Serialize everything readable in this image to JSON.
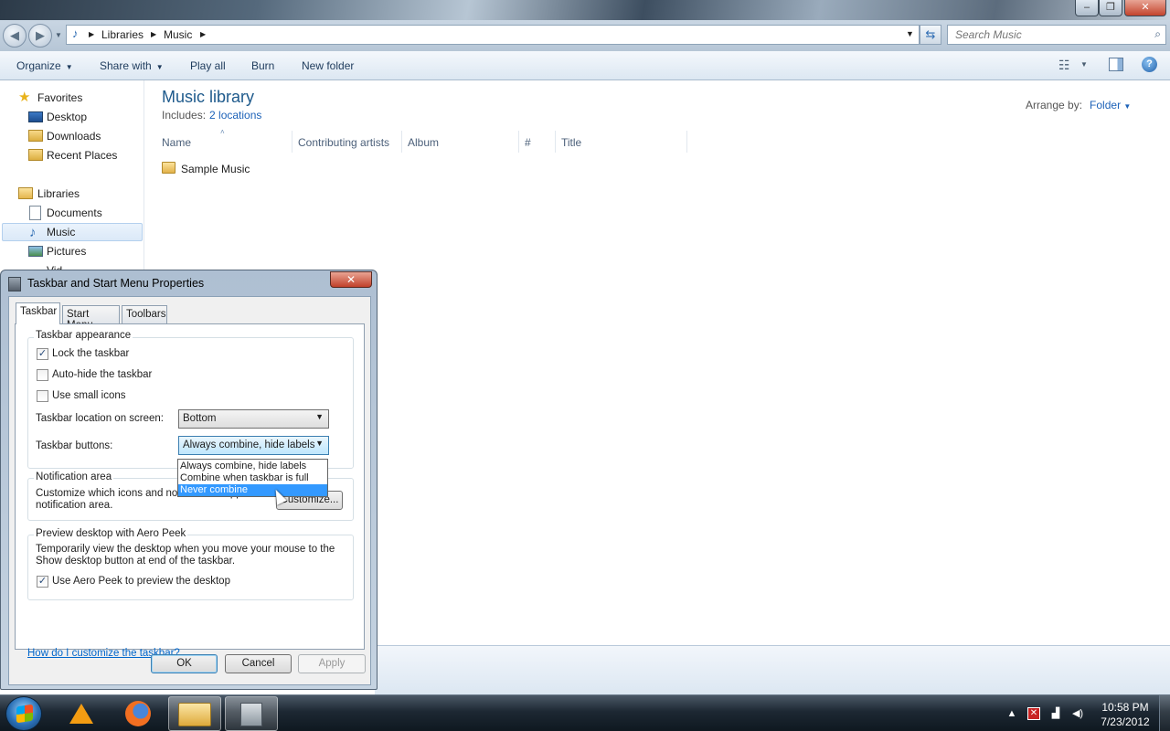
{
  "explorer": {
    "window_controls": {
      "minimize": "‒",
      "maximize": "❐",
      "close": "✕"
    },
    "address": {
      "crumbs": [
        "Libraries",
        "Music"
      ]
    },
    "search": {
      "placeholder": "Search Music"
    },
    "commands": {
      "organize": "Organize",
      "share_with": "Share with",
      "play_all": "Play all",
      "burn": "Burn",
      "new_folder": "New folder"
    },
    "nav": {
      "favorites": "Favorites",
      "desktop": "Desktop",
      "downloads": "Downloads",
      "recent_places": "Recent Places",
      "libraries": "Libraries",
      "documents": "Documents",
      "music": "Music",
      "pictures": "Pictures",
      "videos_partial": "Vid..."
    },
    "library": {
      "title": "Music library",
      "includes_label": "Includes:",
      "includes_link": "2 locations",
      "arrange_label": "Arrange by:",
      "arrange_value": "Folder"
    },
    "columns": [
      "Name",
      "Contributing artists",
      "Album",
      "#",
      "Title"
    ],
    "items": [
      {
        "name": "Sample Music"
      }
    ]
  },
  "dialog": {
    "title": "Taskbar and Start Menu Properties",
    "close": "✕",
    "tabs": [
      "Taskbar",
      "Start Menu",
      "Toolbars"
    ],
    "appearance": {
      "label": "Taskbar appearance",
      "lock": {
        "label": "Lock the taskbar",
        "checked": true
      },
      "autohide": {
        "label": "Auto-hide the taskbar",
        "checked": false
      },
      "small_icons": {
        "label": "Use small icons",
        "checked": false
      },
      "location_label": "Taskbar location on screen:",
      "location_value": "Bottom",
      "buttons_label": "Taskbar buttons:",
      "buttons_value": "Always combine, hide labels",
      "buttons_options": [
        "Always combine, hide labels",
        "Combine when taskbar is full",
        "Never combine"
      ],
      "highlighted_option": "Never combine"
    },
    "notification": {
      "label": "Notification area",
      "text_line1": "Customize which icons and notifications appear in the",
      "text_line2": "notification area.",
      "customize_button": "Customize..."
    },
    "aero_peek": {
      "label": "Preview desktop with Aero Peek",
      "text_line1": "Temporarily view the desktop when you move your mouse to the",
      "text_line2": "Show desktop button at end of the taskbar.",
      "checkbox": {
        "label": "Use Aero Peek to preview the desktop",
        "checked": true
      }
    },
    "help_link": "How do I customize the taskbar?",
    "ok": "OK",
    "cancel": "Cancel",
    "apply": "Apply"
  },
  "taskbar": {
    "apps": [
      "VLC media player",
      "Firefox",
      "Windows Explorer",
      "Taskbar and Start Menu Properties"
    ],
    "clock": {
      "time": "10:58 PM",
      "date": "7/23/2012"
    }
  }
}
